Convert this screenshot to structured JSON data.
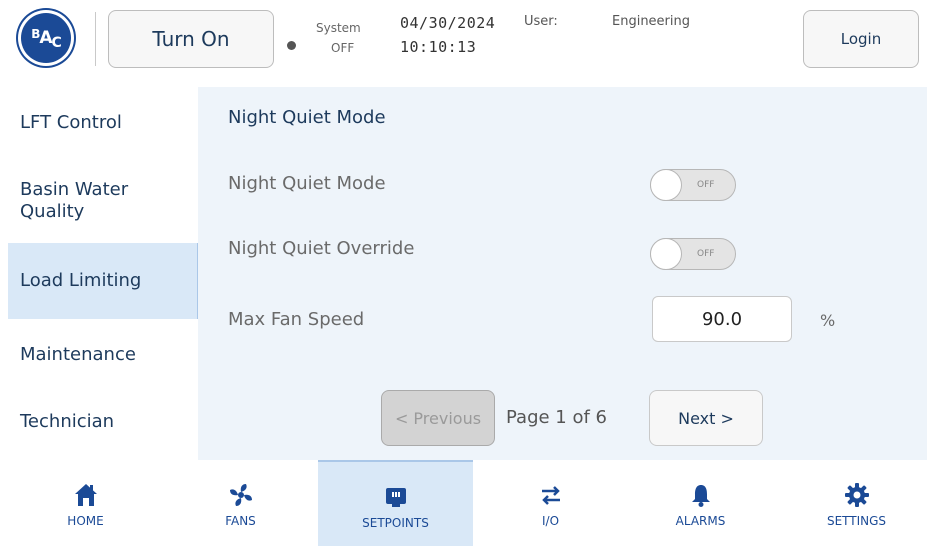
{
  "header": {
    "logo_text": "BAC",
    "power_button_label": "Turn On",
    "system_label": "System",
    "system_status": "OFF",
    "date": "04/30/2024",
    "time": "10:10:13",
    "user_label": "User:",
    "user_value": "Engineering",
    "login_label": "Login"
  },
  "sidebar": {
    "items": [
      {
        "label": "LFT Control",
        "active": false
      },
      {
        "label": "Basin Water Quality",
        "active": false
      },
      {
        "label": "Load Limiting",
        "active": true
      },
      {
        "label": "Maintenance",
        "active": false
      },
      {
        "label": "Technician",
        "active": false
      }
    ]
  },
  "main": {
    "title": "Night Quiet Mode",
    "night_quiet_mode": {
      "label": "Night Quiet Mode",
      "state": "OFF"
    },
    "night_quiet_override": {
      "label": "Night Quiet Override",
      "state": "OFF"
    },
    "max_fan_speed": {
      "label": "Max Fan Speed",
      "value": "90.0",
      "unit": "%"
    },
    "pagination": {
      "previous_label": "< Previous",
      "page_info": "Page 1 of 6",
      "next_label": "Next >"
    }
  },
  "bottom_nav": {
    "items": [
      {
        "label": "HOME",
        "icon": "home-icon"
      },
      {
        "label": "FANS",
        "icon": "fan-icon"
      },
      {
        "label": "SETPOINTS",
        "icon": "setpoints-icon",
        "active": true
      },
      {
        "label": "I/O",
        "icon": "io-arrows-icon"
      },
      {
        "label": "ALARMS",
        "icon": "bell-icon"
      },
      {
        "label": "SETTINGS",
        "icon": "gear-icon"
      }
    ]
  },
  "colors": {
    "brand_blue": "#1b4a96",
    "active_bg": "#d9e8f7",
    "panel_bg": "#eef4fa"
  }
}
